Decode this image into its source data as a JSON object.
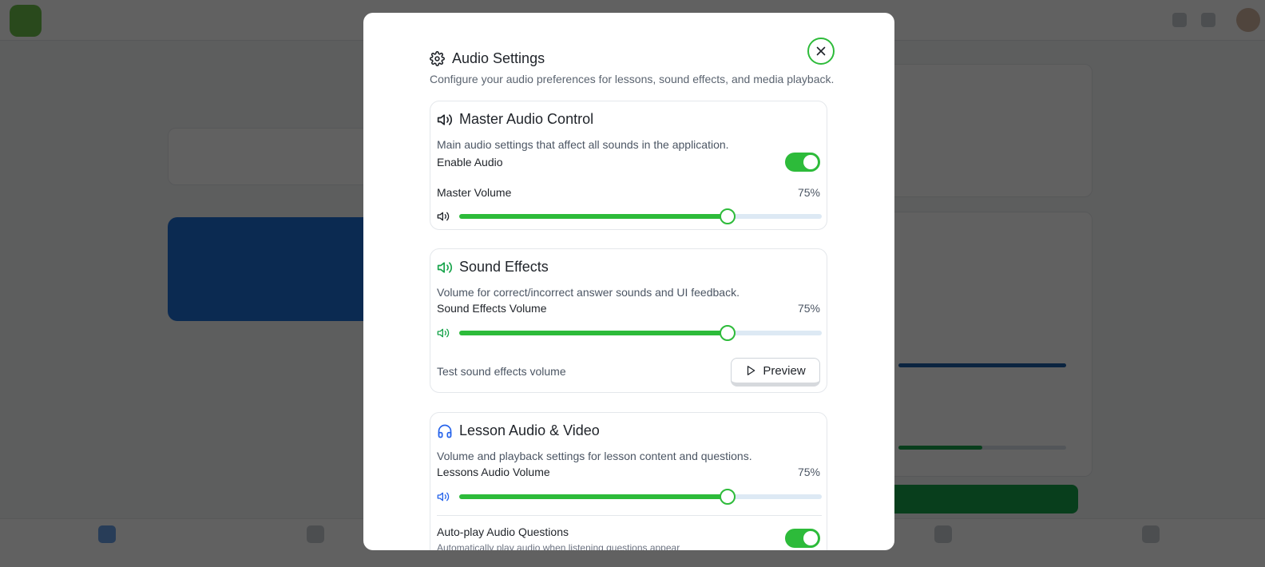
{
  "modal": {
    "title": "Audio Settings",
    "subtitle": "Configure your audio preferences for lessons, sound effects, and media playback.",
    "close_icon": "close-icon"
  },
  "master": {
    "heading": "Master Audio Control",
    "description": "Main audio settings that affect all sounds in the application.",
    "enable_label": "Enable Audio",
    "enable_on": true,
    "volume_label": "Master Volume",
    "volume_value": "75%",
    "volume_level": 0.74
  },
  "effects": {
    "heading": "Sound Effects",
    "description": "Volume for correct/incorrect answer sounds and UI feedback.",
    "volume_label": "Sound Effects Volume",
    "volume_value": "75%",
    "volume_level": 0.74,
    "test_label": "Test sound effects volume",
    "preview_label": "Preview"
  },
  "lessons": {
    "heading": "Lesson Audio & Video",
    "description": "Volume and playback settings for lesson content and questions.",
    "volume_label": "Lessons Audio Volume",
    "volume_value": "75%",
    "volume_level": 0.74,
    "autoplay_label": "Auto-play Audio Questions",
    "autoplay_desc": "Automatically play audio when listening questions appear",
    "autoplay_on": true
  },
  "colors": {
    "accent": "#2dbb3a",
    "track": "#dde9f4",
    "sound_effects_icon": "#16a34a",
    "lesson_icon": "#2563eb"
  }
}
